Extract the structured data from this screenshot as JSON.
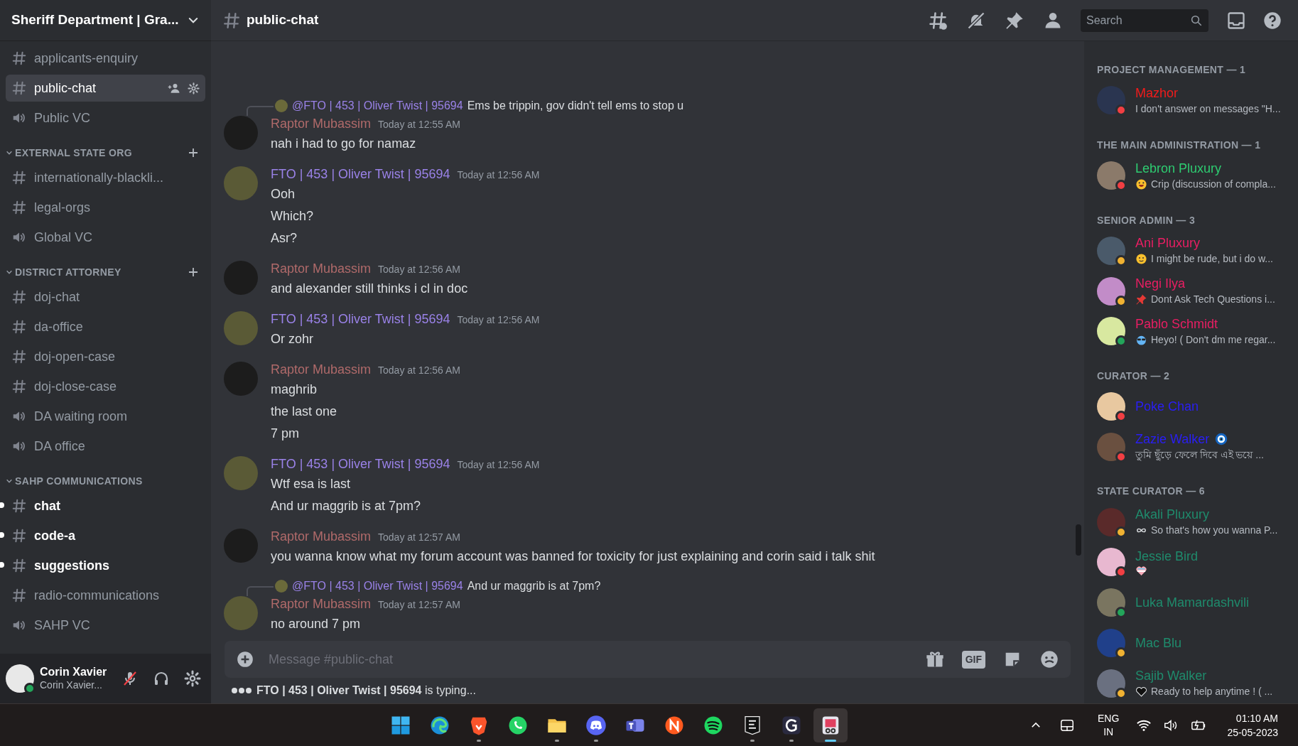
{
  "server": {
    "name": "Sheriff Department | Gra..."
  },
  "channel_list": [
    {
      "kind": "text_channel",
      "name": "applicants-enquiry",
      "selected": false,
      "unread": false
    },
    {
      "kind": "text_channel",
      "name": "public-chat",
      "selected": true,
      "unread": false
    },
    {
      "kind": "voice_channel",
      "name": "Public VC",
      "selected": false,
      "unread": false
    },
    {
      "kind": "category",
      "name": "EXTERNAL STATE ORG",
      "can_add": true
    },
    {
      "kind": "text_channel",
      "name": "internationally-blackli...",
      "selected": false,
      "unread": false
    },
    {
      "kind": "text_channel",
      "name": "legal-orgs",
      "selected": false,
      "unread": false
    },
    {
      "kind": "voice_channel",
      "name": "Global VC",
      "selected": false,
      "unread": false
    },
    {
      "kind": "category",
      "name": "DISTRICT ATTORNEY",
      "can_add": true
    },
    {
      "kind": "text_channel",
      "name": "doj-chat",
      "selected": false,
      "unread": false
    },
    {
      "kind": "text_channel",
      "name": "da-office",
      "selected": false,
      "unread": false
    },
    {
      "kind": "text_channel",
      "name": "doj-open-case",
      "selected": false,
      "unread": false
    },
    {
      "kind": "text_channel",
      "name": "doj-close-case",
      "selected": false,
      "unread": false
    },
    {
      "kind": "voice_channel",
      "name": "DA waiting room",
      "selected": false,
      "unread": false
    },
    {
      "kind": "voice_channel",
      "name": "DA office",
      "selected": false,
      "unread": false
    },
    {
      "kind": "category",
      "name": "SAHP COMMUNICATIONS",
      "can_add": false
    },
    {
      "kind": "text_channel",
      "name": "chat",
      "selected": false,
      "unread": true
    },
    {
      "kind": "text_channel",
      "name": "code-a",
      "selected": false,
      "unread": true
    },
    {
      "kind": "text_channel",
      "name": "suggestions",
      "selected": false,
      "unread": true
    },
    {
      "kind": "text_channel",
      "name": "radio-communications",
      "selected": false,
      "unread": false
    },
    {
      "kind": "voice_channel",
      "name": "SAHP VC",
      "selected": false,
      "unread": false
    }
  ],
  "user_panel": {
    "name": "Corin Xavier",
    "subtext": "Corin Xavier...",
    "status": {
      "color": "#23a55a"
    },
    "muted": true
  },
  "header": {
    "channel": "public-chat",
    "search_placeholder": "Search"
  },
  "messages": [
    {
      "author": "Raptor Mubassim",
      "color": "#b06a6a",
      "time": "Today at 12:55 AM",
      "reply": {
        "mention": "@FTO | 453 | Oliver Twist | 95694",
        "color": "#9a82e8",
        "text": "Ems be trippin, gov didn't tell ems to stop u"
      },
      "lines": [
        "nah i had to go for namaz"
      ]
    },
    {
      "author": "FTO | 453 | Oliver Twist | 95694",
      "color": "#9a82e8",
      "time": "Today at 12:56 AM",
      "lines": [
        "Ooh",
        "Which?",
        "Asr?"
      ]
    },
    {
      "author": "Raptor Mubassim",
      "color": "#b06a6a",
      "time": "Today at 12:56 AM",
      "lines": [
        "and alexander still thinks i cl in doc"
      ]
    },
    {
      "author": "FTO | 453 | Oliver Twist | 95694",
      "color": "#9a82e8",
      "time": "Today at 12:56 AM",
      "lines": [
        "Or zohr"
      ]
    },
    {
      "author": "Raptor Mubassim",
      "color": "#b06a6a",
      "time": "Today at 12:56 AM",
      "lines": [
        "maghrib",
        "the last one",
        "7 pm"
      ]
    },
    {
      "author": "FTO | 453 | Oliver Twist | 95694",
      "color": "#9a82e8",
      "time": "Today at 12:56 AM",
      "lines": [
        "Wtf esa is last",
        "And ur maggrib is at 7pm?"
      ]
    },
    {
      "author": "Raptor Mubassim",
      "color": "#b06a6a",
      "time": "Today at 12:57 AM",
      "lines": [
        "you wanna know what my forum account was banned for toxicity for just explaining and corin said i talk shit"
      ]
    },
    {
      "author": "Raptor Mubassim",
      "color": "#b06a6a",
      "time": "Today at 12:57 AM",
      "reply": {
        "mention": "@FTO | 453 | Oliver Twist | 95694",
        "color": "#9a82e8",
        "text": "And ur maggrib is at 7pm?"
      },
      "lines": [
        "no around 7 pm"
      ]
    }
  ],
  "composer": {
    "placeholder": "Message #public-chat",
    "gif_label": "GIF"
  },
  "typing": "**FTO | 453 | Oliver Twist | 95694** is typing...",
  "member_groups": [
    {
      "title": "PROJECT MANAGEMENT — 1",
      "members": [
        {
          "name": "Mazhor",
          "color": "#f21b1b",
          "status": {
            "color": "#f23f43"
          },
          "activity": {
            "text": "I don't answer on messages \"H..."
          }
        }
      ]
    },
    {
      "title": "THE MAIN ADMINISTRATION — 1",
      "members": [
        {
          "name": "Lebron Pluxury",
          "color": "#2ecc71",
          "status": {
            "color": "#f23f43"
          },
          "activity": {
            "kind": "grin",
            "text": "Crip (discussion of compla..."
          }
        }
      ]
    },
    {
      "title": "SENIOR ADMIN — 3",
      "members": [
        {
          "name": "Ani Pluxury",
          "color": "#e91e63",
          "status": {
            "color": "#f0b232"
          },
          "activity": {
            "kind": "smile",
            "text": "I might be rude, but i do w..."
          }
        },
        {
          "name": "Negi Ilya",
          "color": "#e91e63",
          "status": {
            "color": "#f0b232"
          },
          "activity": {
            "kind": "pin",
            "text": "Dont Ask Tech Questions i..."
          }
        },
        {
          "name": "Pablo Schmidt",
          "color": "#e91e63",
          "status": {
            "color": "#23a55a"
          },
          "activity": {
            "kind": "sunglasses",
            "text": "Heyo! ( Don't dm me regar..."
          }
        }
      ]
    },
    {
      "title": "CURATOR — 2",
      "members": [
        {
          "name": "Poke Chan",
          "color": "#2a1ef5",
          "status": {
            "color": "#f23f43"
          }
        },
        {
          "name": "Zazie Walker",
          "color": "#2a1ef5",
          "status": {
            "color": "#f23f43"
          },
          "name_badge": {
            "kind": "eye"
          },
          "activity": {
            "text": "তুমি ছুঁড়ে ফেলে দিবে এই ভয়ে ..."
          }
        }
      ]
    },
    {
      "title": "STATE CURATOR — 6",
      "members": [
        {
          "name": "Akali Pluxury",
          "color": "#1f8b6c",
          "status": {
            "color": "#f0b232"
          },
          "activity": {
            "kind": "infinity",
            "text": "So that's how you wanna P..."
          }
        },
        {
          "name": "Jessie Bird",
          "color": "#1f8b6c",
          "status": {
            "color": "#f23f43"
          },
          "activity": {
            "kind": "heart_stripes"
          }
        },
        {
          "name": "Luka Mamardashvili",
          "color": "#1f8b6c",
          "status": {
            "color": "#23a55a"
          }
        },
        {
          "name": "Mac Blu",
          "color": "#1f8b6c",
          "status": {
            "color": "#f0b232"
          }
        },
        {
          "name": "Sajib Walker",
          "color": "#1f8b6c",
          "status": {
            "color": "#f0b232"
          },
          "activity": {
            "kind": "heart",
            "text": "Ready to help anytime ! ( ..."
          }
        }
      ]
    }
  ],
  "taskbar": {
    "apps": [
      {
        "kind": "windows",
        "running": false,
        "selected": false
      },
      {
        "kind": "edge",
        "running": false,
        "selected": false
      },
      {
        "kind": "brave",
        "running": true,
        "selected": false
      },
      {
        "kind": "whatsapp",
        "running": false,
        "selected": false
      },
      {
        "kind": "folder",
        "running": true,
        "selected": false
      },
      {
        "kind": "discord",
        "running": true,
        "selected": false
      },
      {
        "kind": "teams",
        "running": false,
        "selected": false
      },
      {
        "kind": "n-app",
        "running": false,
        "selected": false
      },
      {
        "kind": "spotify",
        "running": false,
        "selected": false
      },
      {
        "kind": "epic",
        "running": true,
        "selected": false
      },
      {
        "kind": "g-app",
        "running": true,
        "selected": false
      },
      {
        "kind": "snip",
        "running": true,
        "selected": true
      }
    ],
    "lang": "ENG",
    "region": "IN",
    "time": "01:10 AM",
    "date": "25-05-2023"
  }
}
